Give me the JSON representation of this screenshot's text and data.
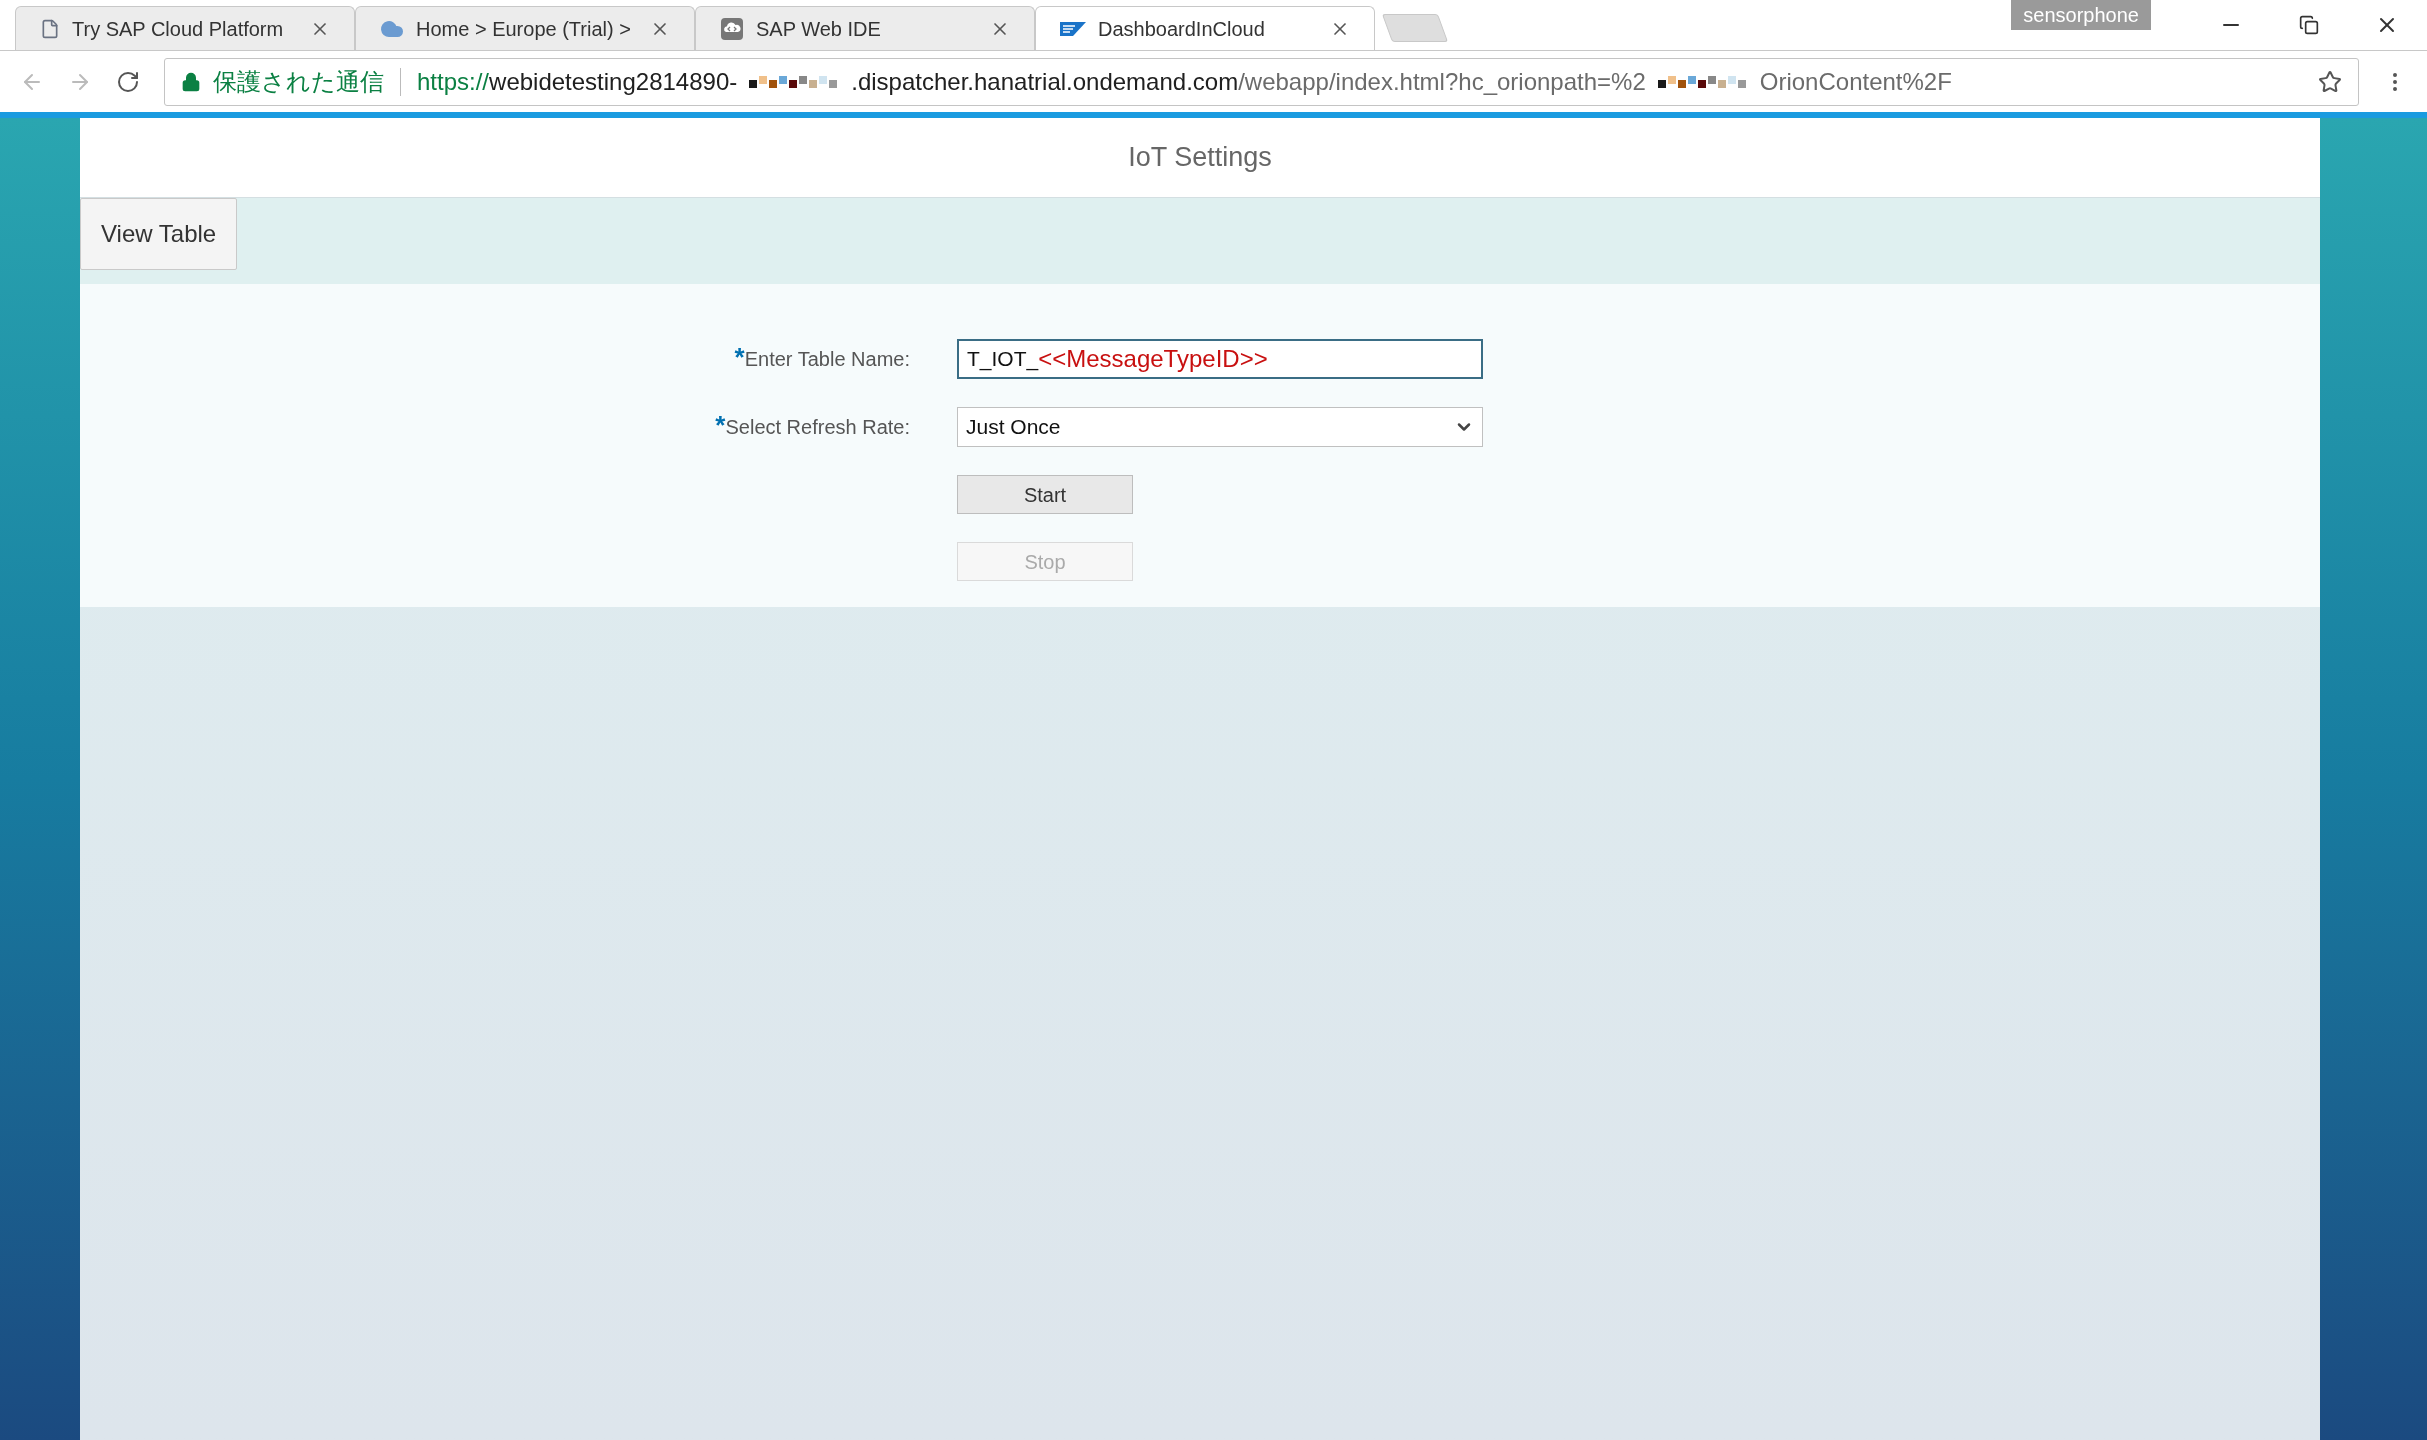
{
  "browser": {
    "tabs": [
      {
        "title": "Try SAP Cloud Platform",
        "kind": "page",
        "selected": false
      },
      {
        "title": "Home > Europe (Trial) >",
        "kind": "cloud",
        "selected": false
      },
      {
        "title": "SAP Web IDE",
        "kind": "ide",
        "selected": false
      },
      {
        "title": "DashboardInCloud",
        "kind": "sap",
        "selected": true
      }
    ],
    "profile": "sensorphone",
    "address_bar": {
      "security_label": "保護された通信",
      "url_parts": [
        {
          "kind": "scheme",
          "text": "https://"
        },
        {
          "kind": "host",
          "text": "webidetesting2814890-"
        },
        {
          "kind": "redacted"
        },
        {
          "kind": "host",
          "text": ".dispatcher.hanatrial.ondemand.com"
        },
        {
          "kind": "path",
          "text": "/webapp/index.html?hc_orionpath=%2"
        },
        {
          "kind": "redacted"
        },
        {
          "kind": "path",
          "text": "OrionContent%2F"
        }
      ]
    }
  },
  "page": {
    "title": "IoT Settings",
    "toolbar_button": "View Table",
    "form": {
      "fields": [
        {
          "kind": "text",
          "required_mark": "*",
          "label": "Enter Table Name:",
          "value": "T_IOT_",
          "value_highlight": "<<MessageTypeID>>"
        },
        {
          "kind": "select",
          "required_mark": "*",
          "label": "Select Refresh Rate:",
          "value": "Just Once"
        }
      ],
      "buttons": [
        {
          "label": "Start",
          "disabled": false
        },
        {
          "label": "Stop",
          "disabled": true
        }
      ]
    }
  }
}
